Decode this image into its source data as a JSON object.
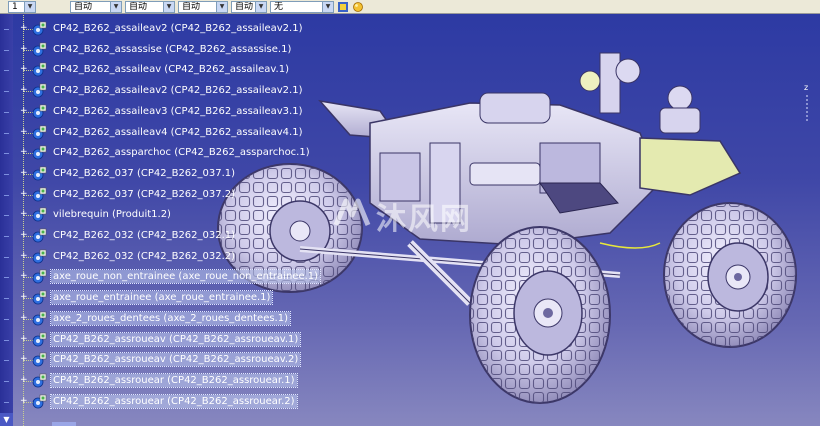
{
  "toolbar": {
    "first_value": "1",
    "combos": [
      {
        "value": "自动"
      },
      {
        "value": "自动"
      },
      {
        "value": "自动"
      },
      {
        "value": "自动"
      },
      {
        "value": "无"
      }
    ]
  },
  "watermark": {
    "text": "沐风网"
  },
  "compass": {
    "label": "z"
  },
  "tree": {
    "items": [
      {
        "label": "CP42_B262_assaileav2 (CP42_B262_assaileav2.1)",
        "selected": false
      },
      {
        "label": "CP42_B262_assassise (CP42_B262_assassise.1)",
        "selected": false
      },
      {
        "label": "CP42_B262_assaileav (CP42_B262_assaileav.1)",
        "selected": false
      },
      {
        "label": "CP42_B262_assaileav2 (CP42_B262_assaileav2.1)",
        "selected": false
      },
      {
        "label": "CP42_B262_assaileav3 (CP42_B262_assaileav3.1)",
        "selected": false
      },
      {
        "label": "CP42_B262_assaileav4 (CP42_B262_assaileav4.1)",
        "selected": false
      },
      {
        "label": "CP42_B262_assparchoc (CP42_B262_assparchoc.1)",
        "selected": false
      },
      {
        "label": "CP42_B262_037 (CP42_B262_037.1)",
        "selected": false
      },
      {
        "label": "CP42_B262_037 (CP42_B262_037.2)",
        "selected": false
      },
      {
        "label": "vilebrequin (Produit1.2)",
        "selected": false
      },
      {
        "label": "CP42_B262_032 (CP42_B262_032.1)",
        "selected": false
      },
      {
        "label": "CP42_B262_032 (CP42_B262_032.2)",
        "selected": false
      },
      {
        "label": "axe_roue_non_entrainee (axe_roue_non_entrainee.1)",
        "selected": true
      },
      {
        "label": "axe_roue_entrainee (axe_roue_entrainee.1)",
        "selected": true
      },
      {
        "label": "axe_2_roues_dentees (axe_2_roues_dentees.1)",
        "selected": true
      },
      {
        "label": "CP42_B262_assroueav (CP42_B262_assroueav.1)",
        "selected": true
      },
      {
        "label": "CP42_B262_assroueav (CP42_B262_assroueav.2)",
        "selected": true
      },
      {
        "label": "CP42_B262_assrouear (CP42_B262_assrouear.1)",
        "selected": true
      },
      {
        "label": "CP42_B262_assrouear (CP42_B262_assrouear.2)",
        "selected": true
      }
    ]
  }
}
